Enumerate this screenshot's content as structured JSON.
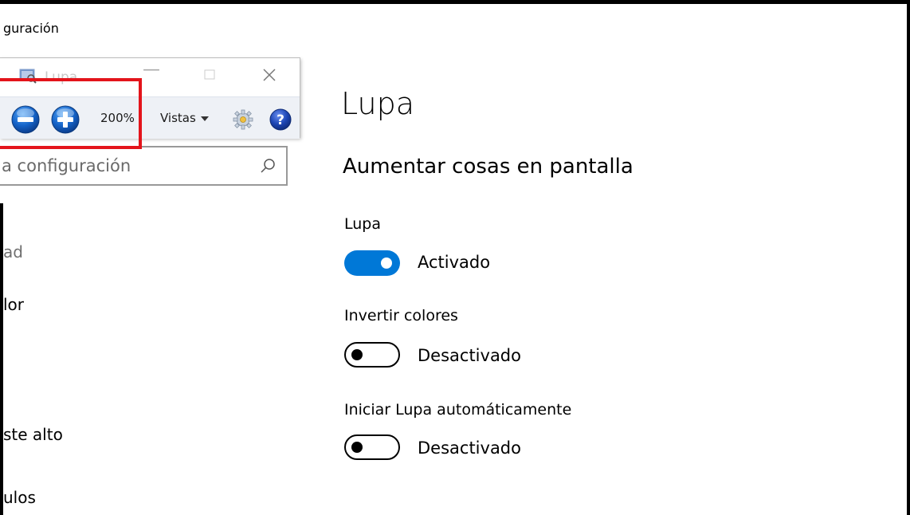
{
  "window": {
    "title": "guración"
  },
  "sidebar": {
    "search": {
      "placeholder": "a configuración"
    },
    "items": [
      {
        "label": "ad",
        "dim": true
      },
      {
        "label": "lor"
      },
      {
        "label": "ste alto"
      },
      {
        "label": "ulos"
      }
    ]
  },
  "magnifier_window": {
    "title": "Lupa",
    "zoom_level": "200%",
    "views_label": "Vistas",
    "icons": {
      "app": "magnifier-app-icon",
      "zoom_out": "minus-icon",
      "zoom_in": "plus-icon",
      "options": "gear-icon",
      "help": "help-icon"
    },
    "highlight_color": "#e3141b"
  },
  "main": {
    "title": "Lupa",
    "section_title": "Aumentar cosas en pantalla",
    "settings": [
      {
        "label": "Lupa",
        "state": "Activado",
        "on": true
      },
      {
        "label": "Invertir colores",
        "state": "Desactivado",
        "on": false
      },
      {
        "label": "Iniciar Lupa automáticamente",
        "state": "Desactivado",
        "on": false
      }
    ],
    "accent_color": "#0078d7"
  }
}
